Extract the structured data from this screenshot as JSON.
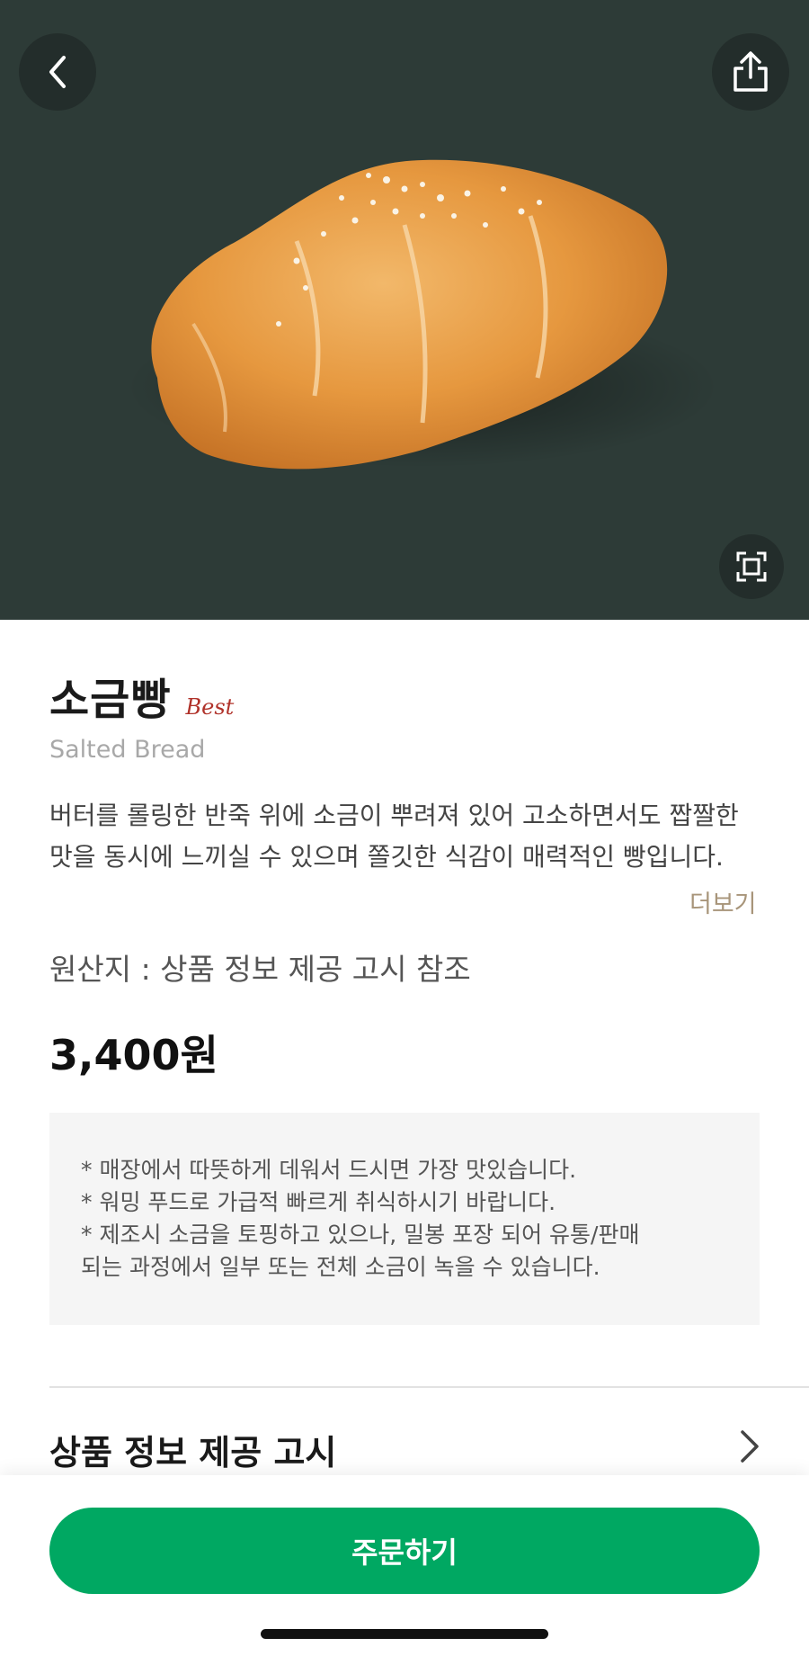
{
  "product": {
    "name": "소금빵",
    "badge": "Best",
    "english_name": "Salted Bread",
    "description": "버터를 롤링한 반죽 위에 소금이 뿌려져 있어 고소하면서도 짭짤한 맛을 동시에 느끼실 수 있으며 쫄깃한 식감이 매력적인 빵입니다.",
    "more_label": "더보기",
    "origin": "원산지 : 상품 정보 제공 고시 참조",
    "price": "3,400원"
  },
  "notice": {
    "lines": [
      "* 매장에서 따뜻하게 데워서 드시면 가장 맛있습니다.",
      "* 워밍 푸드로 가급적 빠르게 취식하시기 바랍니다.",
      "* 제조시 소금을 토핑하고 있으나, 밀봉 포장 되어 유통/판매",
      "되는 과정에서 일부 또는 전체 소금이 녹을 수 있습니다."
    ]
  },
  "info_section": {
    "title": "상품 정보 제공 고시"
  },
  "order_button": {
    "label": "주문하기"
  },
  "icons": {
    "back": "chevron-left-icon",
    "share": "share-icon",
    "expand": "expand-icon",
    "info_chevron": "chevron-right-icon"
  },
  "colors": {
    "hero_bg": "#2d3b37",
    "accent": "#00a862",
    "badge": "#b0322a",
    "more": "#a8957a"
  }
}
